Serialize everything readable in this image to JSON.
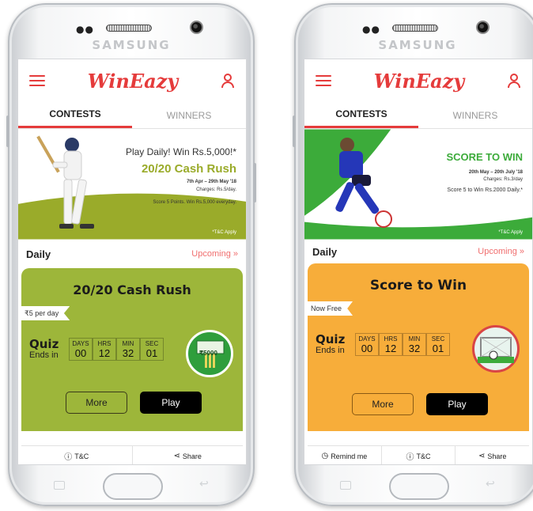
{
  "phones": [
    {
      "brand": "SAMSUNG",
      "app_name": "WinEazy",
      "tabs": [
        {
          "label": "CONTESTS",
          "active": true
        },
        {
          "label": "WINNERS",
          "active": false
        }
      ],
      "banner": {
        "line1": "Play Daily! Win Rs.5,000!*",
        "title": "20/20 Cash Rush",
        "dates": "7th Apr – 29th May '18",
        "charges": "Charges: Rs.5/day.",
        "detail": "Score 5 Points. Win Rs.5,000 everyday.",
        "tnc": "*T&C Apply",
        "accent": "#9aab2a"
      },
      "section_label": "Daily",
      "upcoming_label": "Upcoming »",
      "card": {
        "title": "20/20 Cash Rush",
        "tag": "₹5 per day",
        "quiz_title": "Quiz",
        "ends_in": "Ends in",
        "timer": {
          "labels": [
            "DAYS",
            "HRS",
            "MIN",
            "SEC"
          ],
          "values": [
            "00",
            "12",
            "32",
            "01"
          ]
        },
        "badge_text": "₹5000",
        "more_label": "More",
        "play_label": "Play",
        "color": "#9db63a",
        "badge_color": "#2f9e3c"
      },
      "footer": [
        {
          "icon": "info-icon",
          "label": "T&C"
        },
        {
          "icon": "share-icon",
          "label": "Share"
        }
      ]
    },
    {
      "brand": "SAMSUNG",
      "app_name": "WinEazy",
      "tabs": [
        {
          "label": "CONTESTS",
          "active": true
        },
        {
          "label": "WINNERS",
          "active": false
        }
      ],
      "banner": {
        "title": "SCORE TO WIN",
        "dates": "20th May – 20th July '18",
        "charges": "Charges: Rs.3/day",
        "detail": "Score 5 to Win Rs.2000 Daily.*",
        "tnc": "*T&C Apply",
        "accent": "#3cab3a"
      },
      "section_label": "Daily",
      "upcoming_label": "Upcoming »",
      "card": {
        "title": "Score to Win",
        "tag": "Now Free",
        "quiz_title": "Quiz",
        "ends_in": "Ends in",
        "timer": {
          "labels": [
            "DAYS",
            "HRS",
            "MIN",
            "SEC"
          ],
          "values": [
            "00",
            "12",
            "32",
            "01"
          ]
        },
        "more_label": "More",
        "play_label": "Play",
        "color": "#f7ad3a",
        "badge_color": "#e8f4ee"
      },
      "footer": [
        {
          "icon": "clock-icon",
          "label": "Remind me"
        },
        {
          "icon": "info-icon",
          "label": "T&C"
        },
        {
          "icon": "share-icon",
          "label": "Share"
        }
      ]
    }
  ]
}
